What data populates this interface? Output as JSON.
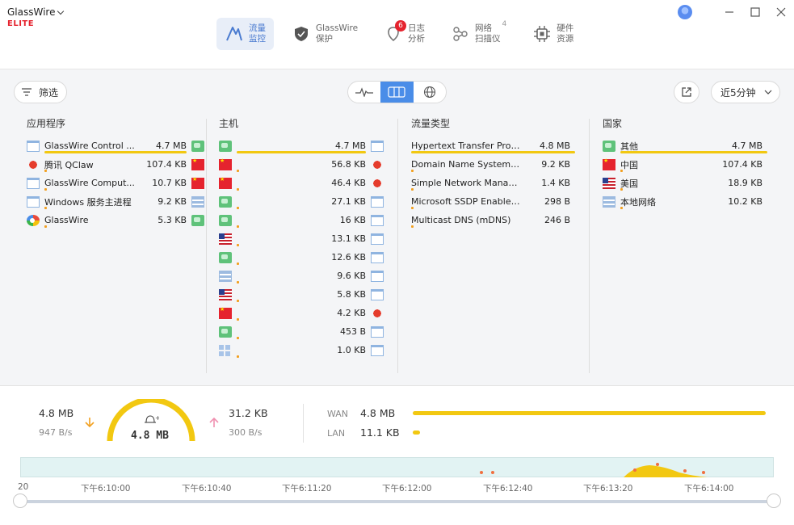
{
  "app": {
    "name": "GlassWire",
    "tier": "ELITE"
  },
  "nav": [
    {
      "label1": "流量",
      "label2": "监控",
      "active": true,
      "icon": "traffic-icon"
    },
    {
      "label1": "GlassWire",
      "label2": "保护",
      "active": false,
      "icon": "shield-icon"
    },
    {
      "label1": "日志",
      "label2": "分析",
      "active": false,
      "icon": "alert-icon",
      "badge": "6"
    },
    {
      "label1": "网络",
      "label2": "扫描仪",
      "active": false,
      "icon": "network-icon",
      "count": "4"
    },
    {
      "label1": "硬件",
      "label2": "资源",
      "active": false,
      "icon": "chip-icon"
    }
  ],
  "toolbar": {
    "filter_label": "筛选",
    "range_label": "近5分钟"
  },
  "columns": {
    "apps": {
      "header": "应用程序",
      "rows": [
        {
          "label": "GlassWire Control ...",
          "value": "4.7 MB",
          "icon": "window",
          "flag": "net",
          "bar": 1.0
        },
        {
          "label": "腾讯 QClaw",
          "value": "107.4 KB",
          "icon": "qq",
          "flag": "cn",
          "bar": 0.02
        },
        {
          "label": "GlassWire Comput...",
          "value": "10.7 KB",
          "icon": "window",
          "flag": "cn",
          "bar": 0
        },
        {
          "label": "Windows 服务主进程",
          "value": "9.2 KB",
          "icon": "window",
          "flag": "lan",
          "bar": 0
        },
        {
          "label": "GlassWire",
          "value": "5.3 KB",
          "icon": "gw",
          "flag": "net",
          "bar": 0
        }
      ]
    },
    "hosts": {
      "header": "主机",
      "rows": [
        {
          "label": "",
          "value": "4.7 MB",
          "icon": "net",
          "flag": "window",
          "bar": 1.0
        },
        {
          "label": "",
          "value": "56.8 KB",
          "icon": "cn",
          "flag": "qq",
          "bar": 0.02
        },
        {
          "label": "",
          "value": "46.4 KB",
          "icon": "cn",
          "flag": "qq",
          "bar": 0.02
        },
        {
          "label": "",
          "value": "27.1 KB",
          "icon": "net",
          "flag": "window",
          "bar": 0.01
        },
        {
          "label": "",
          "value": "16 KB",
          "icon": "net",
          "flag": "window",
          "bar": 0
        },
        {
          "label": "",
          "value": "13.1 KB",
          "icon": "us",
          "flag": "window",
          "bar": 0
        },
        {
          "label": "",
          "value": "12.6 KB",
          "icon": "net",
          "flag": "window",
          "bar": 0
        },
        {
          "label": "",
          "value": "9.6 KB",
          "icon": "lan",
          "flag": "window",
          "bar": 0
        },
        {
          "label": "",
          "value": "5.8 KB",
          "icon": "us",
          "flag": "window",
          "bar": 0
        },
        {
          "label": "",
          "value": "4.2 KB",
          "icon": "cn",
          "flag": "qq",
          "bar": 0
        },
        {
          "label": "",
          "value": "453 B",
          "icon": "net",
          "flag": "window",
          "bar": 0
        },
        {
          "label": "",
          "value": "1.0 KB",
          "icon": "grid",
          "flag": "window",
          "bar": 0
        }
      ]
    },
    "types": {
      "header": "流量类型",
      "rows": [
        {
          "label": "Hypertext Transfer Protocol...",
          "value": "4.8 MB",
          "bar": 1.0
        },
        {
          "label": "Domain Name System (DNS)",
          "value": "9.2 KB",
          "bar": 0
        },
        {
          "label": "Simple Network Manageme...",
          "value": "1.4 KB",
          "bar": 0
        },
        {
          "label": "Microsoft SSDP Enables di...",
          "value": "298 B",
          "bar": 0
        },
        {
          "label": "Multicast DNS (mDNS)",
          "value": "246 B",
          "bar": 0
        }
      ]
    },
    "countries": {
      "header": "国家",
      "rows": [
        {
          "label": "其他",
          "value": "4.7 MB",
          "icon": "net",
          "bar": 1.0
        },
        {
          "label": "中国",
          "value": "107.4 KB",
          "icon": "cn",
          "bar": 0.02
        },
        {
          "label": "美国",
          "value": "18.9 KB",
          "icon": "us",
          "bar": 0
        },
        {
          "label": "本地网络",
          "value": "10.2 KB",
          "icon": "lan",
          "bar": 0
        }
      ]
    }
  },
  "stats": {
    "down_total": "4.8 MB",
    "down_rate": "947 B/s",
    "gauge_total": "4.8 MB",
    "up_total": "31.2 KB",
    "up_rate": "300 B/s",
    "wan_label": "WAN",
    "wan_value": "4.8 MB",
    "wan_fraction": 1.0,
    "lan_label": "LAN",
    "lan_value": "11.1 KB",
    "lan_fraction": 0.02
  },
  "timeline": {
    "ticks": [
      "20",
      "下午6:10:00",
      "下午6:10:40",
      "下午6:11:20",
      "下午6:12:00",
      "下午6:12:40",
      "下午6:13:20",
      "下午6:14:00"
    ]
  },
  "colors": {
    "accent": "#4a8de8",
    "bar": "#f2c811",
    "alert": "#e5232e"
  }
}
